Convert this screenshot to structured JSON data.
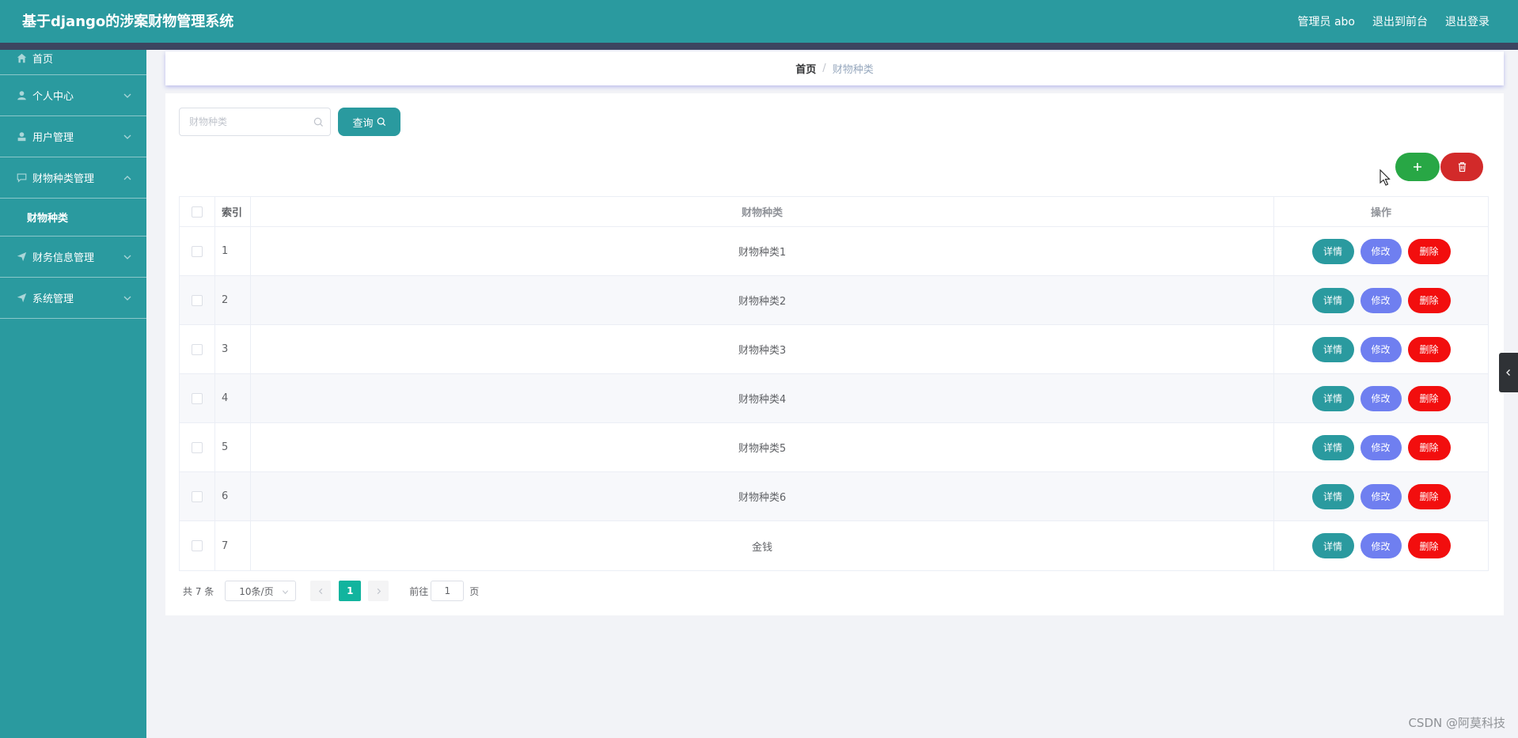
{
  "header": {
    "title": "基于django的涉案财物管理系统",
    "links": [
      "管理员 abo",
      "退出到前台",
      "退出登录"
    ]
  },
  "sidebar": {
    "items": [
      {
        "label": "首页",
        "icon": "home-icon"
      },
      {
        "label": "个人中心",
        "icon": "user-icon"
      },
      {
        "label": "用户管理",
        "icon": "user-manage-icon"
      },
      {
        "label": "财物种类管理",
        "icon": "chat-icon",
        "expanded": true
      },
      {
        "label": "财务信息管理",
        "icon": "send-icon"
      },
      {
        "label": "系统管理",
        "icon": "send-icon"
      }
    ],
    "submenu": {
      "label": "财物种类"
    }
  },
  "breadcrumb": {
    "home": "首页",
    "separator": "/",
    "current": "财物种类"
  },
  "search": {
    "placeholder": "财物种类",
    "button_label": "查询"
  },
  "table": {
    "headers": {
      "index": "索引",
      "name": "财物种类",
      "ops": "操作"
    },
    "rows": [
      {
        "index": "1",
        "name": "财物种类1"
      },
      {
        "index": "2",
        "name": "财物种类2"
      },
      {
        "index": "3",
        "name": "财物种类3"
      },
      {
        "index": "4",
        "name": "财物种类4"
      },
      {
        "index": "5",
        "name": "财物种类5"
      },
      {
        "index": "6",
        "name": "财物种类6"
      },
      {
        "index": "7",
        "name": "金钱"
      }
    ],
    "ops": {
      "detail": "详情",
      "edit": "修改",
      "delete": "删除"
    }
  },
  "pagination": {
    "total": "共 7 条",
    "page_size": "10条/页",
    "current": "1",
    "goto": "前往",
    "goto_value": "1",
    "page_unit": "页"
  },
  "watermark": "CSDN @阿莫科技",
  "colors": {
    "primary": "#2a9a9f",
    "header_strip": "#3c4560",
    "edit": "#6f7ff0",
    "delete": "#f20e0e",
    "add": "#28a745",
    "bulk_delete": "#d22a2a",
    "page_active": "#12b49e"
  }
}
